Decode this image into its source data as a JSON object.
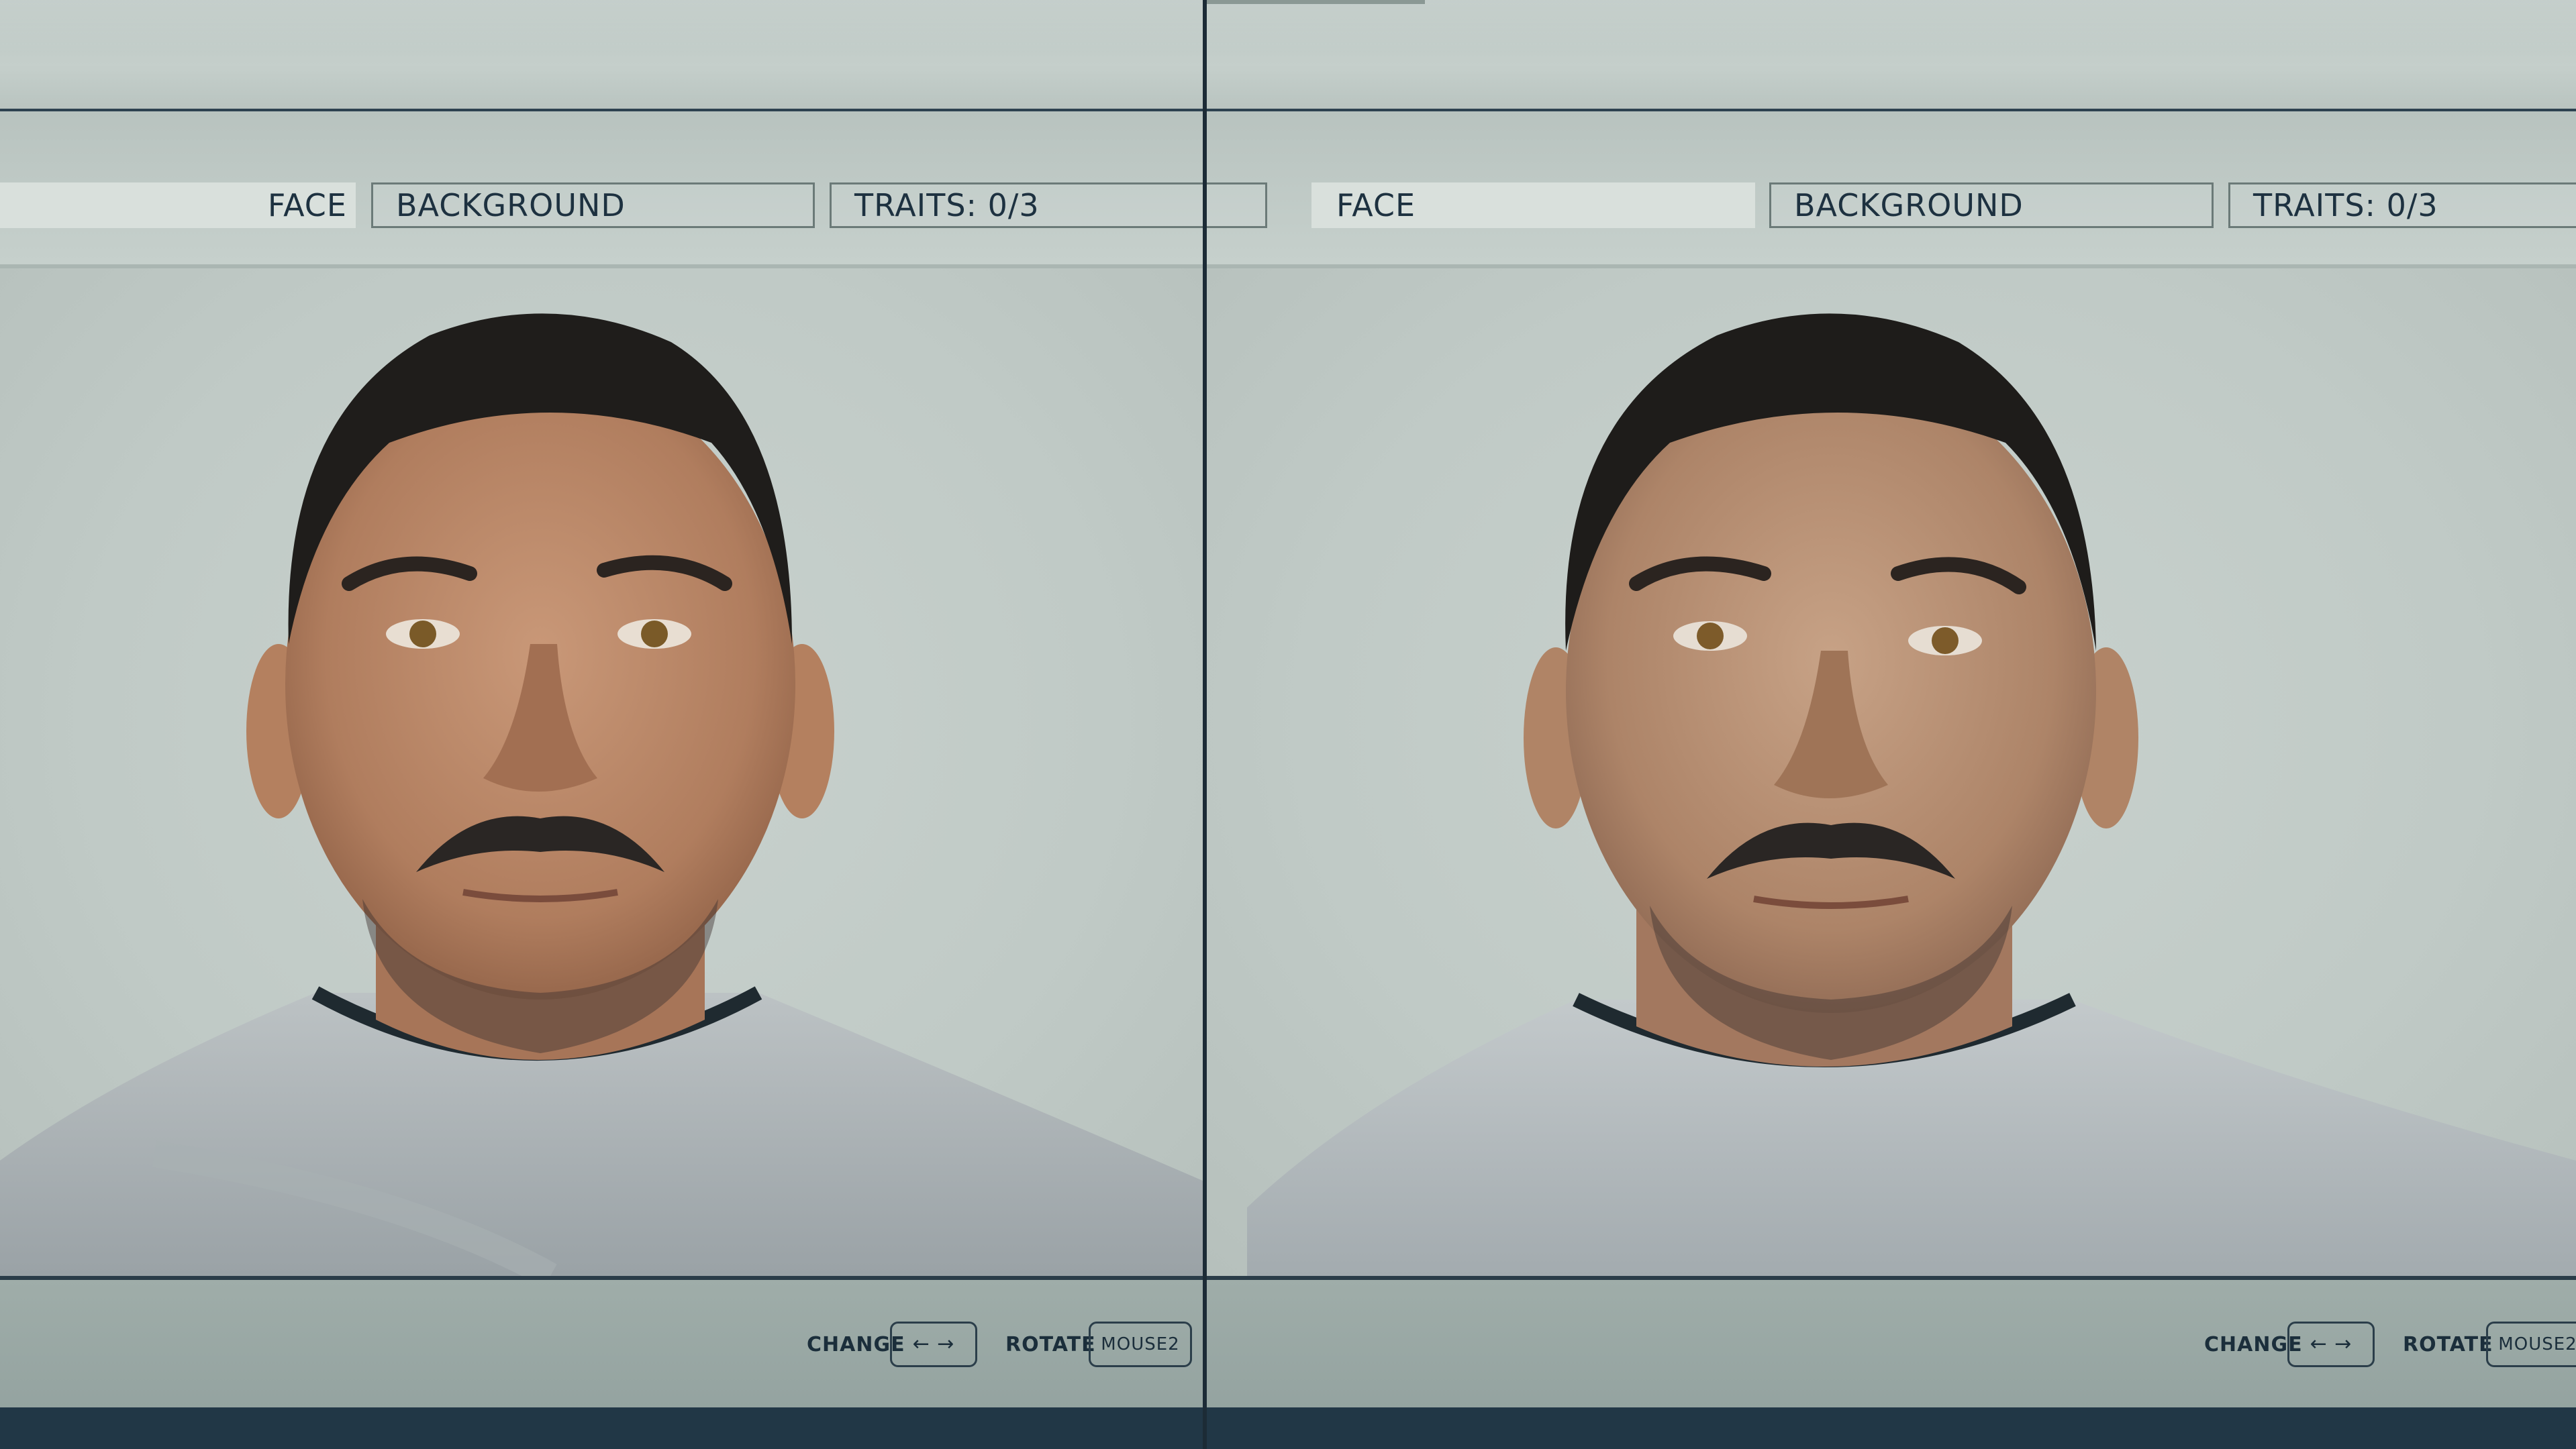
{
  "tabs": {
    "face": "FACE",
    "background": "BACKGROUND",
    "traits": "TRAITS: 0/3"
  },
  "controls": {
    "change_label": "CHANGE",
    "change_keys": "← →",
    "rotate_label": "ROTATE",
    "rotate_key": "MOUSE2"
  },
  "colors": {
    "tab_text": "#1d3140",
    "active_tab_fill": "#d9e0dc",
    "panel_bg": "#c4ceca",
    "bottom_bar": "#9aa8a4",
    "footer": "#213746"
  }
}
